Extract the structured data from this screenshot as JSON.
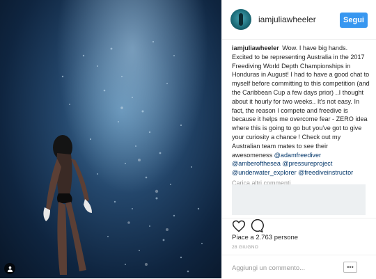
{
  "post": {
    "username": "iamjuliawheeler",
    "follow_label": "Segui",
    "caption": {
      "username": "iamjuliawheeler",
      "text": "Wow. I have big hands. Excited to be representing Australia in the 2017 Freediving World Depth Championships in Honduras in August! I had to have a good chat to myself before committing to this competition (and the Caribbean Cup a few days prior) ..I thought about it hourly for two weeks.. It's not easy. In fact, the reason I compete and freedive is because it helps me overcome fear - ZERO idea where this is going to go but you've got to give your curiosity a chance ! Check out my Australian team mates to see their awesomeness",
      "mentions": [
        "@adamfreediver",
        "@amberofthesea",
        "@pressureproject",
        "@underwater_explorer",
        "@freediveinstructor"
      ]
    },
    "load_more": "Carica altri commenti",
    "likes": "Piace a 2.763 persone",
    "date": "28 GIUGNO",
    "comment_placeholder": "Aggiungi un commento...",
    "more_label": "•••"
  },
  "icons": {
    "heart": "heart-icon",
    "comment": "comment-icon",
    "user_tag": "user-tag-icon",
    "more": "more-options-icon"
  },
  "colors": {
    "accent": "#3897f0",
    "text": "#262626",
    "muted": "#999999",
    "link": "#003569"
  }
}
